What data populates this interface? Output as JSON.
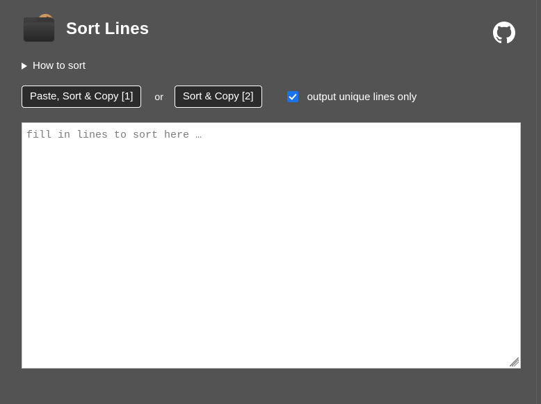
{
  "header": {
    "title": "Sort Lines",
    "logo_icon": "folder-brain-icon",
    "github_icon": "github-icon",
    "github_label": "GitHub"
  },
  "howto": {
    "marker_icon": "disclosure-triangle-icon",
    "label": "How to sort",
    "expanded": false
  },
  "controls": {
    "paste_sort_copy_label": "Paste, Sort & Copy [1]",
    "separator_label": "or",
    "sort_copy_label": "Sort & Copy [2]",
    "unique_checkbox_label": "output unique lines only",
    "unique_checkbox_checked": true,
    "checkbox_icon": "checkmark-icon"
  },
  "editor": {
    "placeholder": "fill in lines to sort here …",
    "value": "",
    "resize_handle_icon": "resize-grip-icon"
  },
  "colors": {
    "background": "#535353",
    "accent": "#1a73e8",
    "button_fill": "#2c2c2c",
    "text": "#ffffff",
    "editor_background": "#ffffff",
    "placeholder_text": "#7d7d7d"
  }
}
